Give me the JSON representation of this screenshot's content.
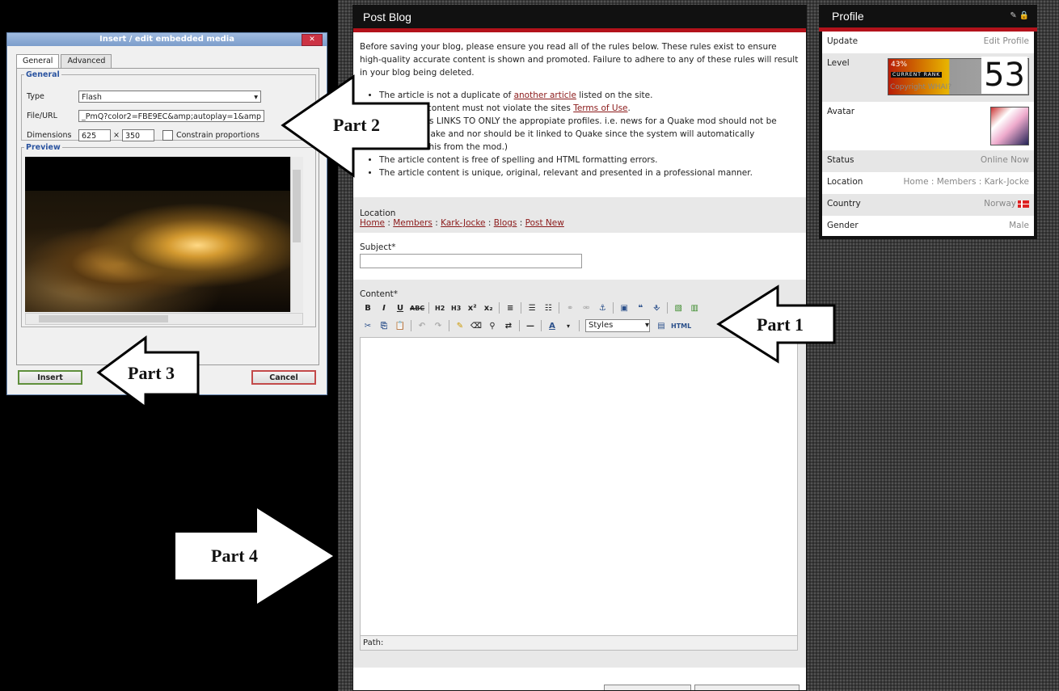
{
  "blog": {
    "title": "Post Blog",
    "rules_intro": "Before saving your blog, please ensure you read all of the rules below. These rules exist to ensure high-quality accurate content is shown and promoted. Failure to adhere to any of these rules will result in your blog being deleted.",
    "rules": [
      {
        "pre": "The article is not a duplicate of ",
        "link": "another article",
        "post": " listed on the site."
      },
      {
        "pre": "The article content must not violate the sites ",
        "link": "Terms of Use",
        "post": "."
      },
      {
        "pre": "The article is LINKS TO ONLY the appropiate profiles. i.e. news for a Quake mod should not be linked to Quake and nor should be it linked to Quake since the system will automatically determine this from the mod.)",
        "link": "",
        "post": ""
      },
      {
        "pre": "The article content is free of spelling and HTML formatting errors.",
        "link": "",
        "post": ""
      },
      {
        "pre": "The article content is unique, original, relevant and presented in a professional manner.",
        "link": "",
        "post": ""
      }
    ],
    "location_label": "Location",
    "breadcrumb": [
      "Home",
      "Members",
      "Kark-Jocke",
      "Blogs",
      "Post New"
    ],
    "breadcrumb_sep": " : ",
    "subject_label": "Subject*",
    "content_label": "Content*",
    "styles_select": "Styles",
    "path_label": "Path:"
  },
  "toolbar": {
    "row1": [
      "B",
      "I",
      "U",
      "ABC",
      "H2",
      "H3",
      "x²",
      "x₂",
      "≡",
      "☰",
      "☷",
      "⚭",
      "⚮",
      "⚓",
      "▣",
      "❝",
      "⎀",
      "▧",
      "▥"
    ],
    "row2": [
      "✂",
      "⎘",
      "📋",
      "↶",
      "↷",
      "✎",
      "⌫",
      "⚲",
      "⇄",
      "—",
      "A"
    ],
    "html_btn": "HTML"
  },
  "profile": {
    "title": "Profile",
    "rows": [
      {
        "label": "Update",
        "value": "Edit Profile"
      },
      {
        "label": "Level",
        "value": ""
      },
      {
        "label": "Avatar",
        "value": ""
      },
      {
        "label": "Status",
        "value": "Online Now"
      },
      {
        "label": "Location",
        "value": "Home : Members : Kark-Jocke"
      },
      {
        "label": "Country",
        "value": "Norway"
      },
      {
        "label": "Gender",
        "value": "Male"
      }
    ],
    "level": {
      "percent": "43%",
      "current_rank": "CURRENT RANK",
      "copyright": "Copyright WHAI?",
      "number": "53"
    }
  },
  "dialog": {
    "title": "Insert / edit embedded media",
    "close": "✕",
    "tabs": [
      "General",
      "Advanced"
    ],
    "general_legend": "General",
    "type_label": "Type",
    "type_value": "Flash",
    "url_label": "File/URL",
    "url_value": "_PmQ?color2=FBE9EC&amp;autoplay=1&amp",
    "dim_label": "Dimensions",
    "width": "625",
    "times": "×",
    "height": "350",
    "constrain": "Constrain proportions",
    "preview_legend": "Preview",
    "insert": "Insert",
    "cancel": "Cancel"
  },
  "annotations": [
    "Part 1",
    "Part 2",
    "Part 3",
    "Part 4"
  ]
}
